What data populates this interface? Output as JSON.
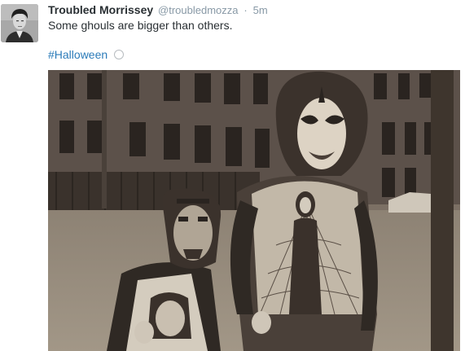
{
  "tweet": {
    "display_name": "Troubled Morrissey",
    "handle": "@troubledmozza",
    "separator": "·",
    "timestamp": "5m",
    "text": "Some ghouls are bigger than others.",
    "hashtag": "#Halloween"
  },
  "icons": {
    "avatar": "profile-photo",
    "emoji": "circle-icon",
    "photo": "halloween-photo"
  },
  "colors": {
    "name": "#292f33",
    "meta": "#8899a6",
    "hashtag": "#2b7bb9"
  }
}
